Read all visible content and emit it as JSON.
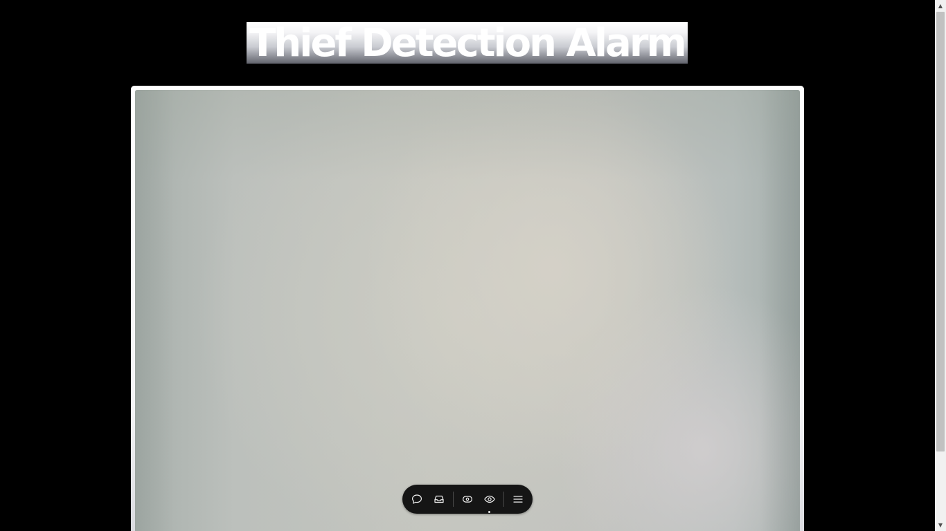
{
  "page": {
    "title": "Thief Detection Alarm",
    "background_color": "#000000"
  },
  "camera": {
    "feed": "webcam-feed"
  },
  "toolbar": {
    "buttons": [
      {
        "icon": "chat-bubble-icon"
      },
      {
        "icon": "inbox-tray-icon"
      },
      {
        "icon": "eye-toggle-icon"
      },
      {
        "icon": "eye-icon",
        "active": true
      },
      {
        "icon": "hamburger-menu-icon"
      }
    ],
    "background_color": "#151515"
  },
  "scrollbar": {
    "up_arrow": "▲",
    "down_arrow": "▼"
  }
}
